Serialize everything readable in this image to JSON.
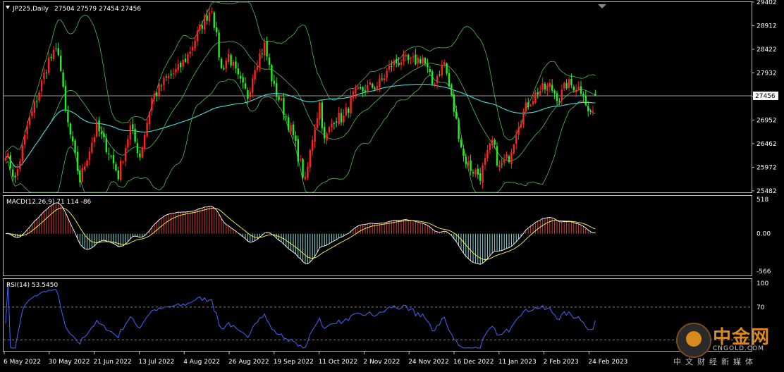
{
  "header": {
    "symbol_label": "JP225,Daily",
    "ohlc_label": "27504 27579 27454 27456"
  },
  "macd_label": "MACD(12,26,9) 71 114 -86",
  "rsi_label": "RSI(14) 53.5450",
  "brand": {
    "name": "中金网",
    "domain": "CNGOLD.COM",
    "slogan": "中文财经新媒体"
  },
  "colors": {
    "bull": "#ff2222",
    "bear": "#22ee22",
    "bollinger": "#55bb55",
    "ma": "#44dddd",
    "macd_pos": "#d43b3b",
    "macd_neg": "#88dddd",
    "signal": "#ffff44",
    "macd_line": "#ffffff",
    "rsi": "#4466ff"
  },
  "chart_data": {
    "type": "candlestick",
    "price_axis": {
      "ticks": [
        25482,
        25972,
        26462,
        26952,
        27442,
        27932,
        28422,
        28912,
        29402
      ],
      "tick_labels": [
        "25482",
        "25972",
        "26462",
        "26952",
        "27442",
        "27932",
        "28422",
        "28912",
        "29402"
      ],
      "range": [
        25450,
        29402
      ],
      "current_price": 27456,
      "current_price_label": "27456"
    },
    "x_axis": {
      "labels": [
        "6 May 2022",
        "30 May 2022",
        "21 Jun 2022",
        "13 Jul 2022",
        "4 Aug 2022",
        "26 Aug 2022",
        "19 Sep 2022",
        "11 Oct 2022",
        "2 Nov 2022",
        "24 Nov 2022",
        "16 Dec 2022",
        "11 Jan 2023",
        "2 Feb 2023",
        "24 Feb 2023"
      ]
    },
    "price_path": [
      {
        "i": 0,
        "v": 26300
      },
      {
        "i": 4,
        "v": 25700
      },
      {
        "i": 9,
        "v": 26800
      },
      {
        "i": 13,
        "v": 27400
      },
      {
        "i": 18,
        "v": 28200
      },
      {
        "i": 22,
        "v": 28400
      },
      {
        "i": 25,
        "v": 27100
      },
      {
        "i": 28,
        "v": 26400
      },
      {
        "i": 31,
        "v": 25700
      },
      {
        "i": 34,
        "v": 26200
      },
      {
        "i": 38,
        "v": 26800
      },
      {
        "i": 43,
        "v": 26300
      },
      {
        "i": 47,
        "v": 25800
      },
      {
        "i": 52,
        "v": 26800
      },
      {
        "i": 56,
        "v": 26200
      },
      {
        "i": 61,
        "v": 27400
      },
      {
        "i": 67,
        "v": 27800
      },
      {
        "i": 72,
        "v": 28000
      },
      {
        "i": 76,
        "v": 28300
      },
      {
        "i": 82,
        "v": 28950
      },
      {
        "i": 86,
        "v": 29300
      },
      {
        "i": 90,
        "v": 28000
      },
      {
        "i": 93,
        "v": 28300
      },
      {
        "i": 97,
        "v": 27800
      },
      {
        "i": 101,
        "v": 27450
      },
      {
        "i": 104,
        "v": 28100
      },
      {
        "i": 108,
        "v": 28500
      },
      {
        "i": 112,
        "v": 27600
      },
      {
        "i": 115,
        "v": 27300
      },
      {
        "i": 120,
        "v": 26600
      },
      {
        "i": 125,
        "v": 25650
      },
      {
        "i": 128,
        "v": 26600
      },
      {
        "i": 131,
        "v": 27300
      },
      {
        "i": 133,
        "v": 26500
      },
      {
        "i": 137,
        "v": 27000
      },
      {
        "i": 141,
        "v": 27000
      },
      {
        "i": 145,
        "v": 27450
      },
      {
        "i": 150,
        "v": 27600
      },
      {
        "i": 156,
        "v": 27700
      },
      {
        "i": 161,
        "v": 28100
      },
      {
        "i": 165,
        "v": 28200
      },
      {
        "i": 169,
        "v": 28150
      },
      {
        "i": 174,
        "v": 28250
      },
      {
        "i": 178,
        "v": 27700
      },
      {
        "i": 183,
        "v": 28150
      },
      {
        "i": 186,
        "v": 27400
      },
      {
        "i": 191,
        "v": 26200
      },
      {
        "i": 194,
        "v": 25950
      },
      {
        "i": 198,
        "v": 25800
      },
      {
        "i": 203,
        "v": 26500
      },
      {
        "i": 206,
        "v": 25950
      },
      {
        "i": 210,
        "v": 26200
      },
      {
        "i": 214,
        "v": 26900
      },
      {
        "i": 218,
        "v": 27300
      },
      {
        "i": 222,
        "v": 27550
      },
      {
        "i": 227,
        "v": 27650
      },
      {
        "i": 231,
        "v": 27400
      },
      {
        "i": 234,
        "v": 27700
      },
      {
        "i": 238,
        "v": 27650
      },
      {
        "i": 241,
        "v": 27550
      },
      {
        "i": 243,
        "v": 27100
      },
      {
        "i": 245,
        "v": 27150
      },
      {
        "i": 246,
        "v": 27456
      }
    ],
    "indicators": {
      "bollinger": {
        "period": 20,
        "deviation": 2
      },
      "moving_average": {
        "period": 100
      },
      "macd": {
        "params": [
          12,
          26,
          9
        ],
        "values": [
          71,
          114,
          -86
        ],
        "axis_ticks": [
          518,
          0.0,
          -566
        ],
        "axis_labels": [
          "518",
          "0.00",
          "-566"
        ]
      },
      "rsi": {
        "period": 14,
        "value": 53.545,
        "levels": [
          30,
          70
        ],
        "axis_labels": [
          "100",
          "70"
        ]
      }
    }
  }
}
